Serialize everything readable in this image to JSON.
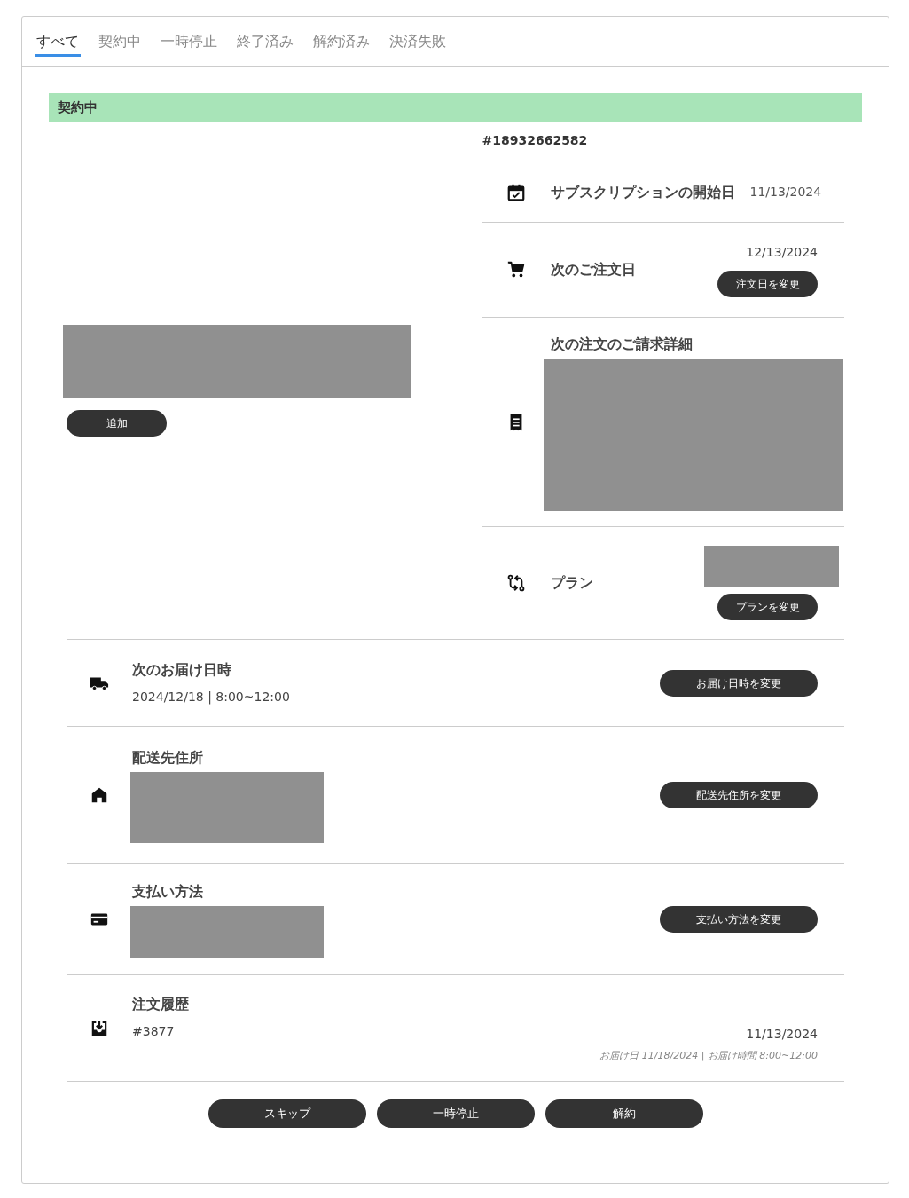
{
  "tabs": [
    {
      "label": "すべて",
      "selected": true
    },
    {
      "label": "契約中",
      "selected": false
    },
    {
      "label": "一時停止",
      "selected": false
    },
    {
      "label": "終了済み",
      "selected": false
    },
    {
      "label": "解約済み",
      "selected": false
    },
    {
      "label": "決済失敗",
      "selected": false
    }
  ],
  "status_banner": "契約中",
  "product": {
    "button": "追加"
  },
  "subscription_id": "#18932662582",
  "details": [
    {
      "kind": "start_date",
      "label": "サブスクリプションの開始日",
      "value": "11/13/2024"
    },
    {
      "kind": "next_order",
      "label": "次のご注文日",
      "value": "12/13/2024",
      "button": "注文日を変更"
    },
    {
      "kind": "billing",
      "label": "次の注文のご請求詳細"
    },
    {
      "kind": "plan",
      "label": "プラン",
      "button": "プランを変更"
    }
  ],
  "sections": [
    {
      "kind": "delivery",
      "label": "次のお届け日時",
      "value": "2024/12/18 | 8:00~12:00",
      "button": "お届け日時を変更"
    },
    {
      "kind": "address",
      "label": "配送先住所",
      "button": "配送先住所を変更"
    },
    {
      "kind": "payment",
      "label": "支払い方法",
      "button": "支払い方法を変更"
    },
    {
      "kind": "history",
      "label": "注文履歴",
      "value": "#3877",
      "date": "11/13/2024",
      "note": "お届け日 11/18/2024 | お届け時間 8:00~12:00"
    }
  ],
  "actions": [
    "スキップ",
    "一時停止",
    "解約"
  ]
}
